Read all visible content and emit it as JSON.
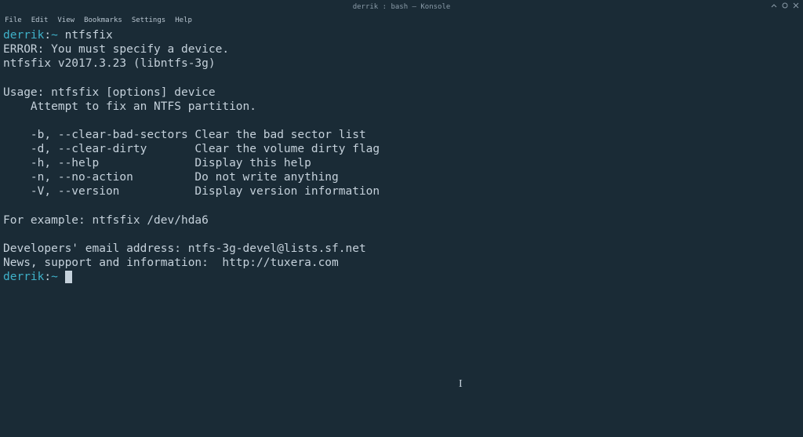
{
  "window": {
    "title": "derrik : bash — Konsole"
  },
  "menu": {
    "items": [
      "File",
      "Edit",
      "View",
      "Bookmarks",
      "Settings",
      "Help"
    ]
  },
  "terminal": {
    "prompt_user": "derrik",
    "prompt_sep": ":",
    "prompt_tilde": "~",
    "command1": "ntfsfix",
    "lines": [
      "ERROR: You must specify a device.",
      "ntfsfix v2017.3.23 (libntfs-3g)",
      "",
      "Usage: ntfsfix [options] device",
      "    Attempt to fix an NTFS partition.",
      "",
      "    -b, --clear-bad-sectors Clear the bad sector list",
      "    -d, --clear-dirty       Clear the volume dirty flag",
      "    -h, --help              Display this help",
      "    -n, --no-action         Do not write anything",
      "    -V, --version           Display version information",
      "",
      "For example: ntfsfix /dev/hda6",
      "",
      "Developers' email address: ntfs-3g-devel@lists.sf.net",
      "News, support and information:  http://tuxera.com"
    ]
  }
}
